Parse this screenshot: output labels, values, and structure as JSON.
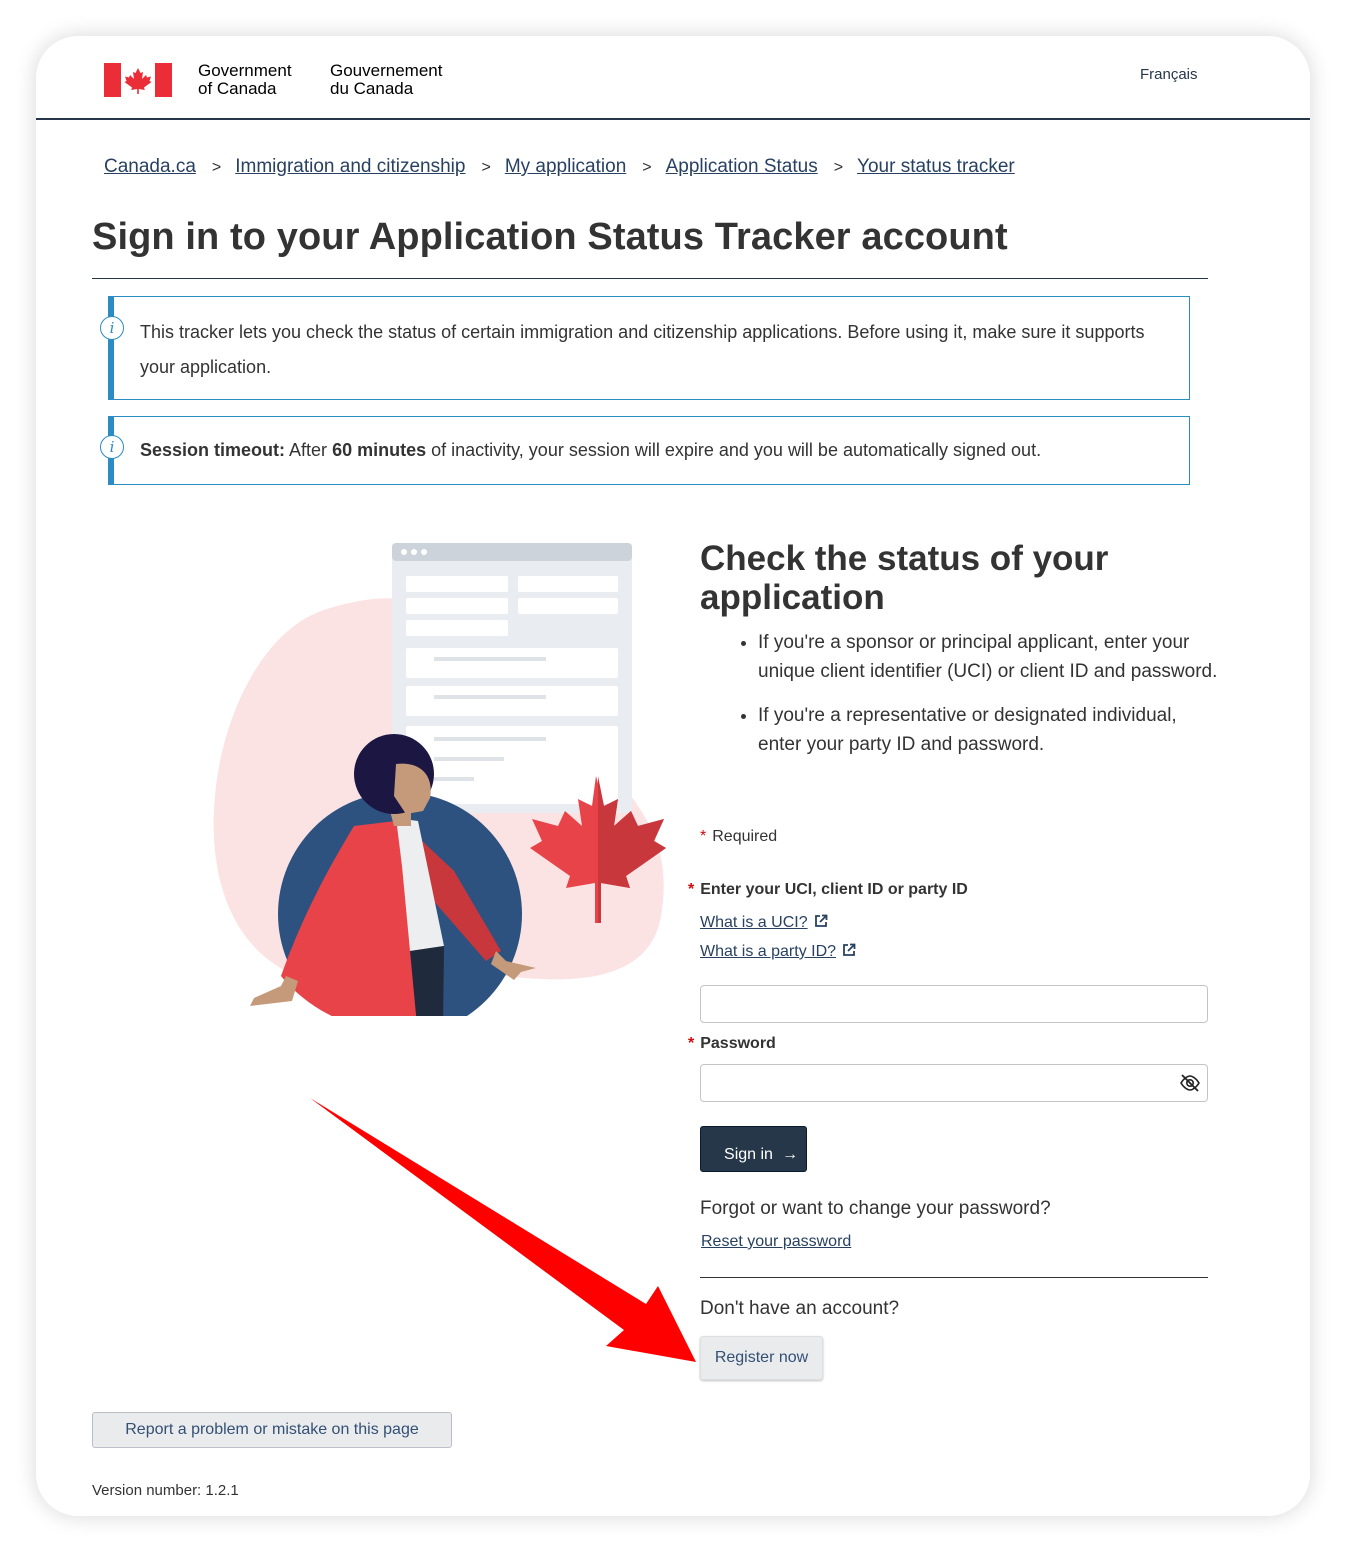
{
  "header": {
    "gov_en_line1": "Government",
    "gov_en_line2": "of Canada",
    "gov_fr_line1": "Gouvernement",
    "gov_fr_line2": "du Canada",
    "language_toggle": "Français"
  },
  "breadcrumb": {
    "separator": ">",
    "items": [
      {
        "label": "Canada.ca"
      },
      {
        "label": "Immigration and citizenship"
      },
      {
        "label": "My application"
      },
      {
        "label": "Application Status"
      },
      {
        "label": "Your status tracker"
      }
    ]
  },
  "page": {
    "title": "Sign in to your Application Status Tracker account"
  },
  "alerts": {
    "info_icon": "i",
    "tracker_notice": "This tracker lets you check the status of certain immigration and citizenship applications. Before using it, make sure it supports your application.",
    "session_label": "Session timeout:",
    "session_pre": " After ",
    "session_minutes": "60 minutes",
    "session_post": " of inactivity, your session will expire and you will be automatically signed out."
  },
  "form": {
    "heading": "Check the status of your application",
    "bullets": [
      "If you're a sponsor or principal applicant, enter your unique client identifier (UCI) or client ID and password.",
      "If you're a representative or designated individual, enter your party ID and password."
    ],
    "required_marker": "*",
    "required_note": "Required",
    "uci_label": "Enter your UCI, client ID or party ID",
    "uci_help_link": "What is a UCI?",
    "party_help_link": "What is a party ID?",
    "uci_value": "",
    "password_label": "Password",
    "password_value": "",
    "sign_in_button": "Sign in",
    "sign_in_arrow": "→",
    "forgot_question": "Forgot or want to change your password?",
    "reset_link": "Reset your password",
    "no_account_question": "Don't have an account?",
    "register_button": "Register now"
  },
  "footer": {
    "report_button": "Report a problem or mistake on this page",
    "version": "Version number: 1.2.1"
  },
  "colors": {
    "brand_navy": "#26374a",
    "link": "#284162",
    "alert_border": "#2b8cc4",
    "required_star": "#d3080c",
    "flag_red": "#eb2d37",
    "annotation_arrow": "#ff0000"
  },
  "icons": {
    "flag": "canada-flag-icon",
    "info": "info-icon",
    "external": "external-link-icon",
    "eye": "eye-slash-icon",
    "arrow": "arrow-right-icon"
  }
}
